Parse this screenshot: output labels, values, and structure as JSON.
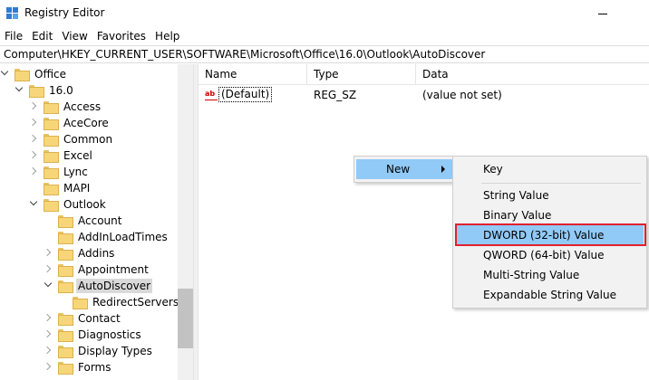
{
  "window": {
    "title": "Registry Editor"
  },
  "menubar": [
    "File",
    "Edit",
    "View",
    "Favorites",
    "Help"
  ],
  "address": "Computer\\HKEY_CURRENT_USER\\SOFTWARE\\Microsoft\\Office\\16.0\\Outlook\\AutoDiscover",
  "tree": {
    "items": [
      {
        "label": "Office",
        "level": 0,
        "expander": "down"
      },
      {
        "label": "16.0",
        "level": 1,
        "expander": "down"
      },
      {
        "label": "Access",
        "level": 2,
        "expander": "right"
      },
      {
        "label": "AceCore",
        "level": 2,
        "expander": "right"
      },
      {
        "label": "Common",
        "level": 2,
        "expander": "right"
      },
      {
        "label": "Excel",
        "level": 2,
        "expander": "right"
      },
      {
        "label": "Lync",
        "level": 2,
        "expander": "right"
      },
      {
        "label": "MAPI",
        "level": 2,
        "expander": "none"
      },
      {
        "label": "Outlook",
        "level": 2,
        "expander": "down"
      },
      {
        "label": "Account",
        "level": 3,
        "expander": "none"
      },
      {
        "label": "AddInLoadTimes",
        "level": 3,
        "expander": "none"
      },
      {
        "label": "Addins",
        "level": 3,
        "expander": "right"
      },
      {
        "label": "Appointment",
        "level": 3,
        "expander": "right"
      },
      {
        "label": "AutoDiscover",
        "level": 3,
        "expander": "down",
        "selected": true
      },
      {
        "label": "RedirectServers",
        "level": 4,
        "expander": "none"
      },
      {
        "label": "Contact",
        "level": 3,
        "expander": "right"
      },
      {
        "label": "Diagnostics",
        "level": 3,
        "expander": "right"
      },
      {
        "label": "Display Types",
        "level": 3,
        "expander": "right"
      },
      {
        "label": "Forms",
        "level": 3,
        "expander": "right"
      }
    ]
  },
  "list": {
    "columns": [
      "Name",
      "Type",
      "Data"
    ],
    "rows": [
      {
        "icon": "ab",
        "name": "(Default)",
        "type": "REG_SZ",
        "data": "(value not set)"
      }
    ]
  },
  "context_menu": {
    "new_label": "New",
    "submenu": [
      "Key",
      "String Value",
      "Binary Value",
      "DWORD (32-bit) Value",
      "QWORD (64-bit) Value",
      "Multi-String Value",
      "Expandable String Value"
    ],
    "highlighted": "DWORD (32-bit) Value"
  },
  "colors": {
    "highlight": "#91c9f7",
    "callout": "#e0212e",
    "folder": "#f7d67a"
  }
}
